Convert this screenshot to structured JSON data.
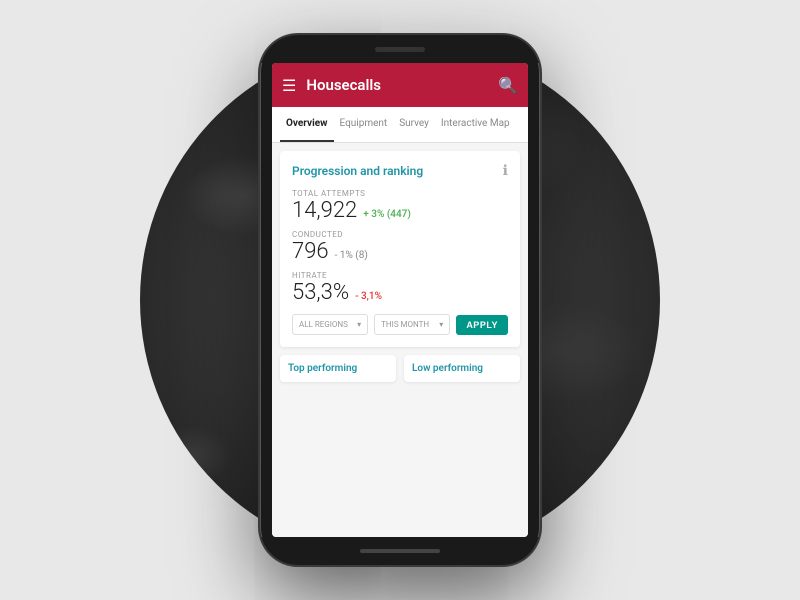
{
  "background": {
    "circle_color": "#4a4a4a"
  },
  "phone": {
    "header": {
      "menu_label": "☰",
      "title": "Housecalls",
      "search_label": "🔍"
    },
    "nav": {
      "tabs": [
        {
          "label": "Overview",
          "active": true
        },
        {
          "label": "Equipment",
          "active": false
        },
        {
          "label": "Survey",
          "active": false
        },
        {
          "label": "Interactive Map",
          "active": false
        }
      ]
    },
    "card": {
      "title": "Progression and ranking",
      "info_icon": "ℹ",
      "stats": [
        {
          "label": "TOTAL ATTEMPTS",
          "value": "14,922",
          "change": "+ 3% (447)",
          "change_type": "positive"
        },
        {
          "label": "CONDUCTED",
          "value": "796",
          "change": "- 1% (8)",
          "change_type": "neutral"
        },
        {
          "label": "HITRATE",
          "value": "53,3%",
          "change": "- 3,1%",
          "change_type": "negative"
        }
      ],
      "filters": {
        "region_label": "ALL REGIONS",
        "region_arrow": "▾",
        "month_label": "THIS MONTH",
        "month_arrow": "▾",
        "apply_label": "APPLY"
      }
    },
    "bottom": {
      "left_label": "Top performing",
      "right_label": "Low performing"
    }
  }
}
